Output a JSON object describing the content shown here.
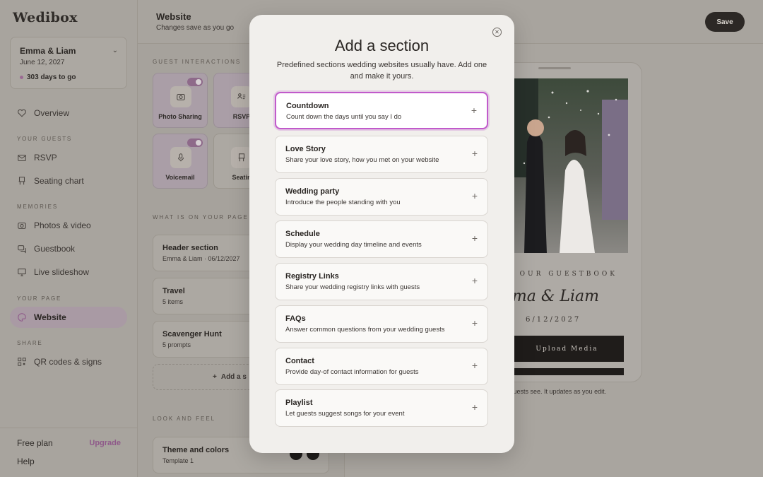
{
  "brand": {
    "logo": "Wedibox"
  },
  "event": {
    "name": "Emma & Liam",
    "date": "June 12, 2027",
    "countdown": "303 days to go"
  },
  "sidebar": {
    "overview": "Overview",
    "sections": {
      "guests": "YOUR GUESTS",
      "memories": "MEMORIES",
      "page": "YOUR PAGE",
      "share": "SHARE"
    },
    "items": {
      "rsvp": "RSVP",
      "seating": "Seating chart",
      "photos": "Photos & video",
      "guestbook": "Guestbook",
      "slideshow": "Live slideshow",
      "website": "Website",
      "qr": "QR codes & signs"
    },
    "plan": "Free plan",
    "upgrade": "Upgrade",
    "help": "Help"
  },
  "header": {
    "title": "Website",
    "subtitle": "Changes save as you go",
    "save": "Save"
  },
  "panel": {
    "guest_interactions": "GUEST INTERACTIONS",
    "tiles": {
      "photo_sharing": "Photo Sharing",
      "rsvp": "RSVP",
      "voicemail": "Voicemail",
      "seating": "Seatin"
    },
    "on_page": "WHAT IS ON YOUR PAGE",
    "items": [
      {
        "title": "Header section",
        "sub": "Emma & Liam · 06/12/2027"
      },
      {
        "title": "Travel",
        "sub": "5 items"
      },
      {
        "title": "Scavenger Hunt",
        "sub": "5 prompts"
      }
    ],
    "add_section": "Add a s",
    "look_feel": "LOOK AND FEEL",
    "theme": {
      "title": "Theme and colors",
      "sub": "Template 1"
    }
  },
  "preview": {
    "guestbook_label": "OUR GUESTBOOK",
    "couple": "mma & Liam",
    "date": "6/12/2027",
    "upload": "Upload Media",
    "note": "r guests see. It updates as you edit."
  },
  "modal": {
    "title": "Add a section",
    "subtitle": "Predefined sections wedding websites usually have. Add one and make it yours.",
    "options": [
      {
        "title": "Countdown",
        "desc": "Count down the days until you say I do"
      },
      {
        "title": "Love Story",
        "desc": "Share your love story, how you met on your website"
      },
      {
        "title": "Wedding party",
        "desc": "Introduce the people standing with you"
      },
      {
        "title": "Schedule",
        "desc": "Display your wedding day timeline and events"
      },
      {
        "title": "Registry Links",
        "desc": "Share your wedding registry links with guests"
      },
      {
        "title": "FAQs",
        "desc": "Answer common questions from your wedding guests"
      },
      {
        "title": "Contact",
        "desc": "Provide day-of contact information for guests"
      },
      {
        "title": "Playlist",
        "desc": "Let guests suggest songs for your event"
      }
    ]
  }
}
